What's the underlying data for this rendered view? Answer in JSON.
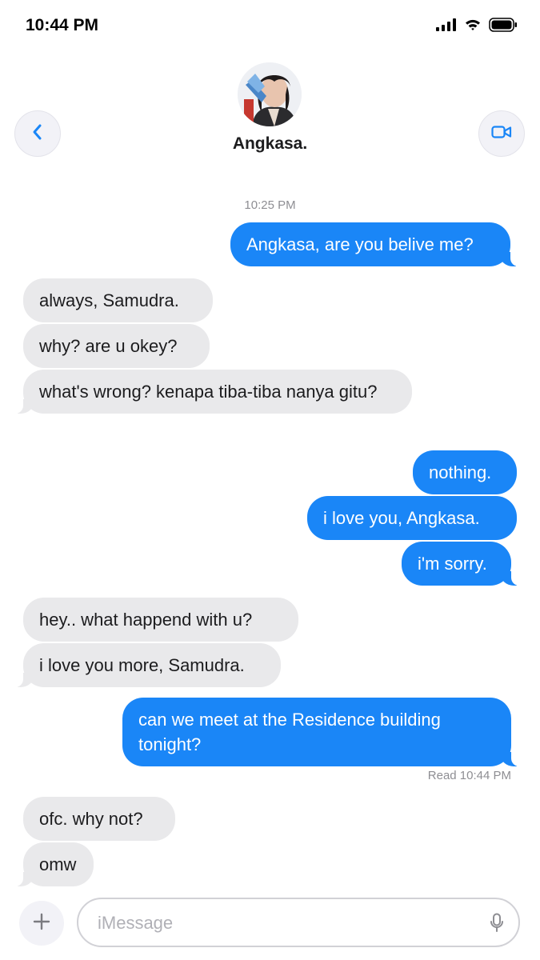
{
  "status_bar": {
    "time": "10:44 PM",
    "icons": [
      "signal-icon",
      "wifi-icon",
      "battery-icon"
    ]
  },
  "header": {
    "contact_name": "Angkasa.",
    "back_icon": "chevron-left-icon",
    "video_icon": "video-camera-icon"
  },
  "conversation": {
    "timestamp": "10:25 PM",
    "messages": [
      {
        "from": "me",
        "text": "Angkasa, are you belive me?"
      },
      {
        "from": "them",
        "text": "always, Samudra."
      },
      {
        "from": "them",
        "text": "why? are u okey?"
      },
      {
        "from": "them",
        "text": "what's wrong? kenapa tiba-tiba nanya gitu?"
      },
      {
        "from": "me",
        "text": "nothing."
      },
      {
        "from": "me",
        "text": "i love you, Angkasa."
      },
      {
        "from": "me",
        "text": "i'm sorry."
      },
      {
        "from": "them",
        "text": "hey.. what happend with u?"
      },
      {
        "from": "them",
        "text": "i love you more, Samudra."
      },
      {
        "from": "me",
        "text": "can we meet at the Residence building tonight?"
      },
      {
        "from": "them",
        "text": "ofc. why not?"
      },
      {
        "from": "them",
        "text": "omw"
      }
    ],
    "read_receipt": "Read 10:44 PM"
  },
  "input_bar": {
    "placeholder": "iMessage",
    "value": "",
    "plus_icon": "plus-icon",
    "mic_icon": "microphone-icon"
  },
  "colors": {
    "sent_bubble": "#1a86f7",
    "received_bubble": "#e9e9eb",
    "accent": "#1a86f7"
  }
}
